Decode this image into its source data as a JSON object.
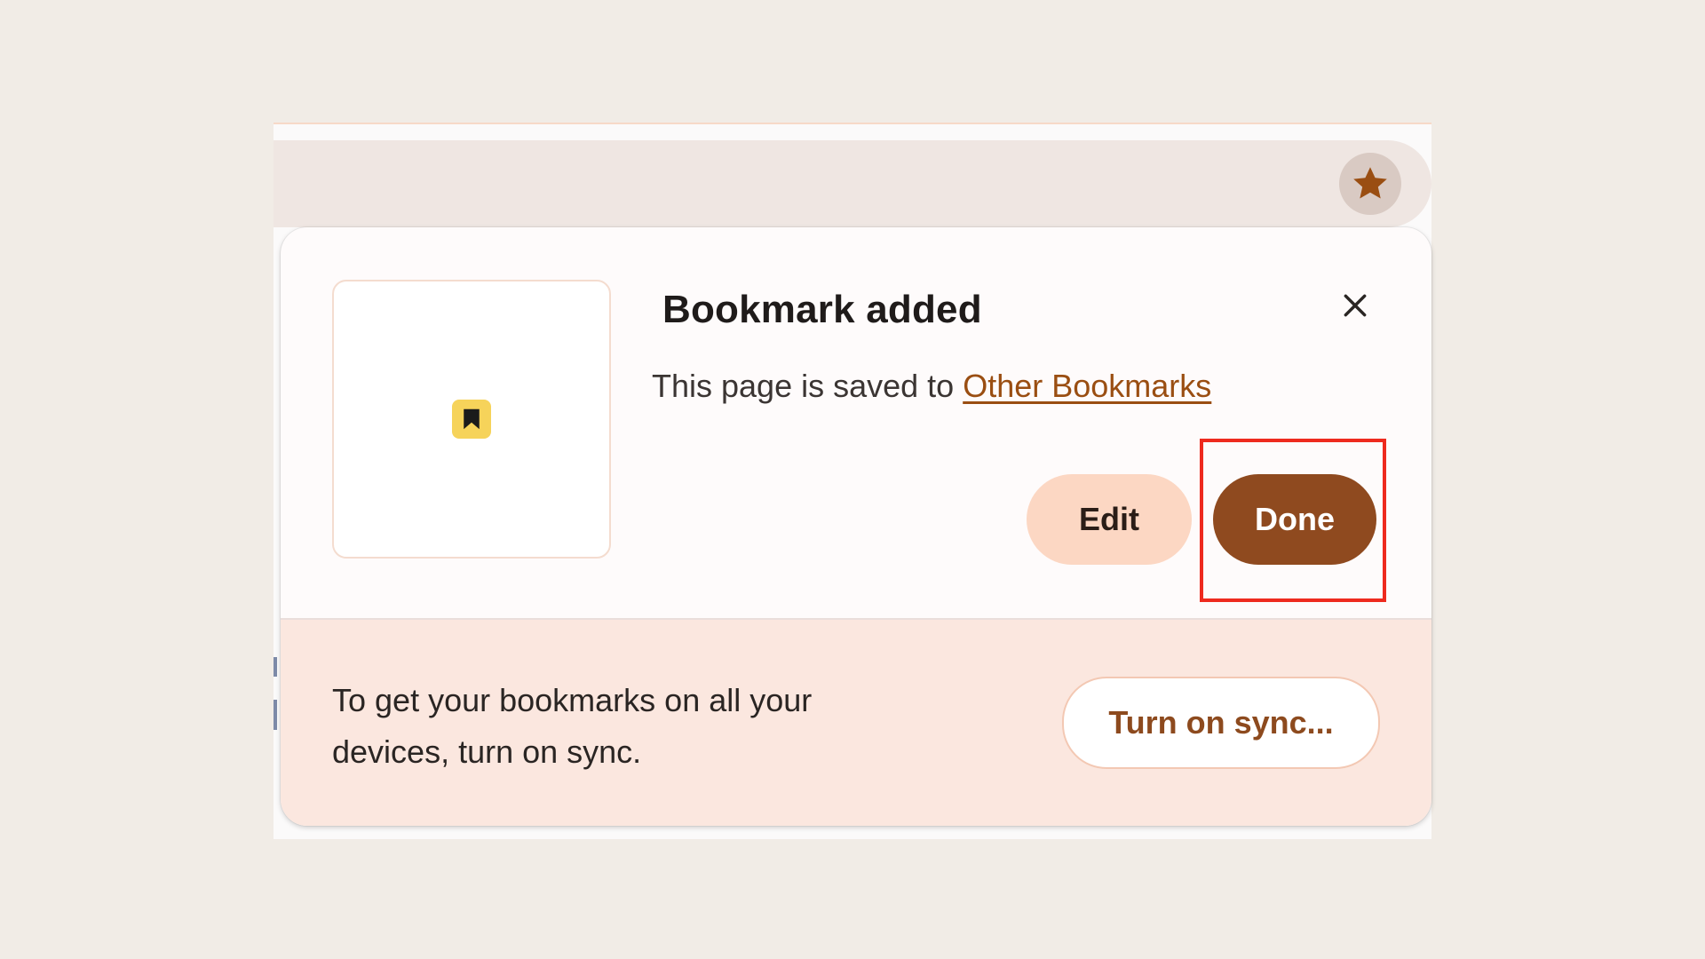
{
  "popup": {
    "title": "Bookmark added",
    "saved_text": "This page is saved to",
    "folder_link": "Other Bookmarks",
    "edit_label": "Edit",
    "done_label": "Done"
  },
  "footer": {
    "message": "To get your bookmarks on all your devices, turn on sync.",
    "sync_label": "Turn on sync..."
  },
  "icons": {
    "star": "star-icon",
    "close": "close-icon",
    "bookmark": "bookmark-icon"
  },
  "colors": {
    "accent": "#8f4a1f",
    "star": "#9a4e12",
    "highlight": "#ee2a1e",
    "badge": "#f6d35a"
  }
}
